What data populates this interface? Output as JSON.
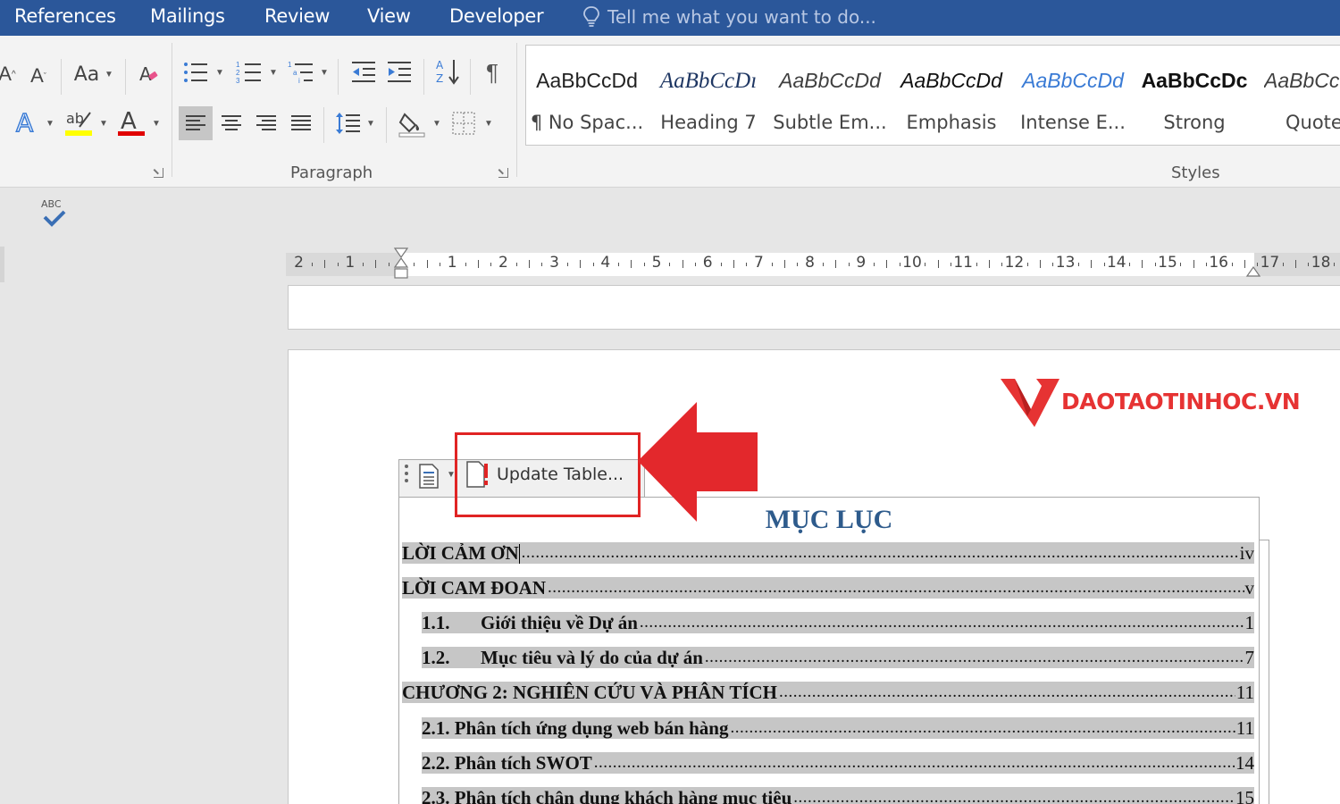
{
  "tabs": [
    "References",
    "Mailings",
    "Review",
    "View",
    "Developer"
  ],
  "tell_me": {
    "placeholder": "Tell me what you want to do..."
  },
  "ribbon": {
    "font_group": {
      "change_case_label": "Aa"
    },
    "paragraph_group": {
      "label": "Paragraph"
    },
    "styles_group": {
      "label": "Styles",
      "items": [
        {
          "preview": "AaBbCcDd",
          "name": "¶ No Spac...",
          "style": "normal"
        },
        {
          "preview": "AaBbCcDı",
          "name": "Heading 7",
          "style": "italic-heading"
        },
        {
          "preview": "AaBbCcDd",
          "name": "Subtle Em...",
          "style": "italic"
        },
        {
          "preview": "AaBbCcDd",
          "name": "Emphasis",
          "style": "italic-dark"
        },
        {
          "preview": "AaBbCcDd",
          "name": "Intense E...",
          "style": "italic-blue"
        },
        {
          "preview": "AaBbCcDc",
          "name": "Strong",
          "style": "bold"
        },
        {
          "preview": "AaBbCcDd",
          "name": "Quote",
          "style": "italic"
        }
      ]
    },
    "colors": {
      "highlight": "#ffff00",
      "font_color": "#e00000"
    }
  },
  "spell_check": {
    "label": "ABC"
  },
  "ruler": {
    "labels": [
      "2",
      "1",
      "",
      "1",
      "2",
      "3",
      "4",
      "5",
      "6",
      "7",
      "8",
      "9",
      "10",
      "11",
      "12",
      "13",
      "14",
      "15",
      "16",
      "17",
      "18"
    ]
  },
  "logo": {
    "text": "DAOTAOTINHOC.VN",
    "color": "#e63333"
  },
  "toc_control": {
    "update_label": "Update Table...",
    "title": "MỤC LỤC",
    "entries": [
      {
        "num": "",
        "text": "LỜI CẢM ƠN",
        "page": "iv",
        "indent": false,
        "caret": true
      },
      {
        "num": "",
        "text": "LỜI CAM ĐOAN",
        "page": "v",
        "indent": false,
        "caret": false
      },
      {
        "num": "1.1.",
        "text": "Giới thiệu về Dự án",
        "page": "1",
        "indent": true,
        "caret": false
      },
      {
        "num": "1.2.",
        "text": "Mục tiêu và lý do của dự án",
        "page": "7",
        "indent": true,
        "caret": false
      },
      {
        "num": "",
        "text": "CHƯƠNG 2: NGHIÊN CỨU VÀ PHÂN TÍCH",
        "page": "11",
        "indent": false,
        "caret": false
      },
      {
        "num": "",
        "text": "2.1.  Phân tích ứng dụng web bán hàng",
        "page": "11",
        "indent": true,
        "caret": false
      },
      {
        "num": "",
        "text": "2.2. Phân tích SWOT",
        "page": "14",
        "indent": true,
        "caret": false
      },
      {
        "num": "",
        "text": "2.3. Phân tích chân dung khách hàng mục tiêu",
        "page": "15",
        "indent": true,
        "caret": false
      }
    ]
  },
  "accent_colors": {
    "title_bar": "#2b579a",
    "heading": "#2e5b8c",
    "highlight_box": "#e02424"
  }
}
